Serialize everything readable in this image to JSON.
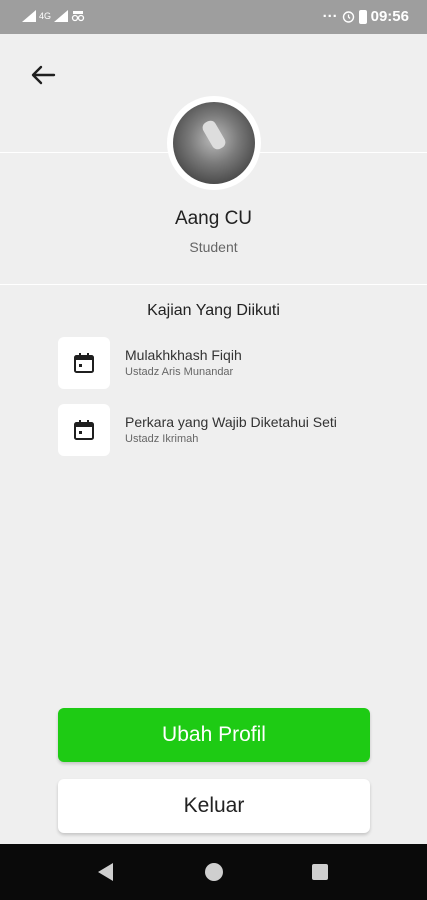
{
  "status_bar": {
    "left_small_label": "4G",
    "time": "09:56",
    "overflow_label": "···"
  },
  "profile": {
    "name": "Aang CU",
    "role": "Student"
  },
  "kajian": {
    "title": "Kajian Yang Diikuti",
    "items": [
      {
        "title": "Mulakhkhash Fiqih",
        "teacher": "Ustadz Aris Munandar"
      },
      {
        "title": "Perkara yang Wajib Diketahui Seti",
        "teacher": "Ustadz Ikrimah"
      }
    ]
  },
  "actions": {
    "edit_profile_label": "Ubah Profil",
    "logout_label": "Keluar"
  },
  "icons": {
    "back": "arrow-left-icon",
    "calendar": "calendar-icon",
    "nav_back": "triangle-back-icon",
    "nav_home": "circle-home-icon",
    "nav_recent": "square-recent-icon"
  },
  "colors": {
    "primary_button": "#1ecb14",
    "background": "#efefef",
    "status_bar": "#9e9e9e",
    "nav_bar": "#0a0a0a"
  }
}
